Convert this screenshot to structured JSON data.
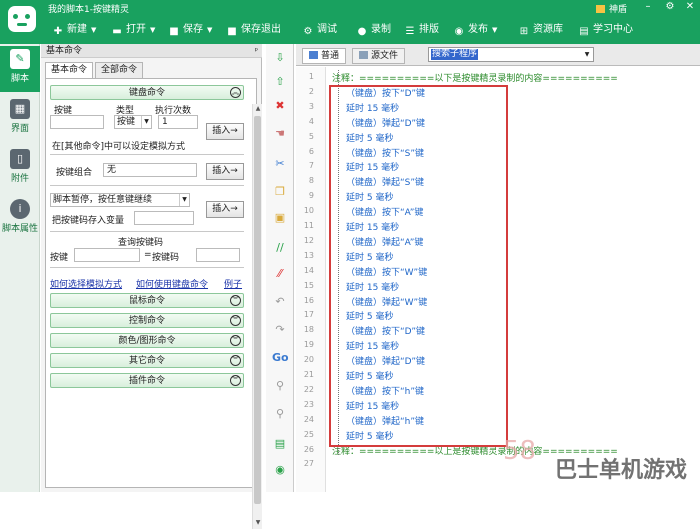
{
  "titlebar": {
    "title": "我的脚本1-按键精灵",
    "user": "神盾",
    "minimize": "–",
    "close": "✕",
    "settings": "⚙"
  },
  "toolbar": {
    "new": "新建",
    "open": "打开",
    "save": "保存",
    "save_exit": "保存退出",
    "debug": "调试",
    "record": "录制",
    "layout": "排版",
    "publish": "发布",
    "resources": "资源库",
    "learning": "学习中心"
  },
  "leftnav": {
    "items": [
      {
        "label": "脚本",
        "icon": "script-icon"
      },
      {
        "label": "界面",
        "icon": "grid-icon"
      },
      {
        "label": "附件",
        "icon": "attachment-icon"
      },
      {
        "label": "脚本属性",
        "icon": "info-icon"
      }
    ]
  },
  "cmdpanel": {
    "header": "基本命令",
    "pin": "ᵖ",
    "tabs": [
      "基本命令",
      "全部命令"
    ],
    "keyboard": {
      "group": "键盘命令",
      "col_key": "按键",
      "col_type": "类型",
      "col_count": "执行次数",
      "type_value": "按键",
      "count_value": "1",
      "insert": "插入→",
      "hint": "在[其他命令]中可以设定模拟方式",
      "combo_label": "按键组合",
      "combo_value": "无"
    },
    "pause": {
      "select_value": "脚本暂停，按任意键继续",
      "var_label": "把按键码存入变量",
      "insert": "插入→"
    },
    "query": {
      "title": "查询按键码",
      "key_label": "按键",
      "eq": "=",
      "code_label": "按键码"
    },
    "links": [
      "如何选择模拟方式",
      "如何使用键盘命令",
      "例子"
    ],
    "groups": [
      "鼠标命令",
      "控制命令",
      "颜色/图形命令",
      "其它命令",
      "插件命令"
    ]
  },
  "editor": {
    "tabs": [
      "普通",
      "源文件"
    ],
    "search": "搜索子程序",
    "lines": [
      {
        "n": "1",
        "text": "注释：==========以下是按键精灵录制的内容==========",
        "kind": "comment"
      },
      {
        "n": "2",
        "text": "（键盘）按下“D”键",
        "kind": "key"
      },
      {
        "n": "3",
        "text": "延时 15 毫秒",
        "kind": "delay"
      },
      {
        "n": "4",
        "text": "（键盘）弹起“D”键",
        "kind": "key"
      },
      {
        "n": "5",
        "text": "延时 5 毫秒",
        "kind": "delay"
      },
      {
        "n": "6",
        "text": "（键盘）按下“S”键",
        "kind": "key"
      },
      {
        "n": "7",
        "text": "延时 15 毫秒",
        "kind": "delay"
      },
      {
        "n": "8",
        "text": "（键盘）弹起“S”键",
        "kind": "key"
      },
      {
        "n": "9",
        "text": "延时 5 毫秒",
        "kind": "delay"
      },
      {
        "n": "10",
        "text": "（键盘）按下“A”键",
        "kind": "key"
      },
      {
        "n": "11",
        "text": "延时 15 毫秒",
        "kind": "delay"
      },
      {
        "n": "12",
        "text": "（键盘）弹起“A”键",
        "kind": "key"
      },
      {
        "n": "13",
        "text": "延时 5 毫秒",
        "kind": "delay"
      },
      {
        "n": "14",
        "text": "（键盘）按下“W”键",
        "kind": "key"
      },
      {
        "n": "15",
        "text": "延时 15 毫秒",
        "kind": "delay"
      },
      {
        "n": "16",
        "text": "（键盘）弹起“W”键",
        "kind": "key"
      },
      {
        "n": "17",
        "text": "延时 5 毫秒",
        "kind": "delay"
      },
      {
        "n": "18",
        "text": "（键盘）按下“D”键",
        "kind": "key"
      },
      {
        "n": "19",
        "text": "延时 15 毫秒",
        "kind": "delay"
      },
      {
        "n": "20",
        "text": "（键盘）弹起“D”键",
        "kind": "key"
      },
      {
        "n": "21",
        "text": "延时 5 毫秒",
        "kind": "delay"
      },
      {
        "n": "22",
        "text": "（键盘）按下“h”键",
        "kind": "key"
      },
      {
        "n": "23",
        "text": "延时 15 毫秒",
        "kind": "delay"
      },
      {
        "n": "24",
        "text": "（键盘）弹起“h”键",
        "kind": "key"
      },
      {
        "n": "25",
        "text": "延时 5 毫秒",
        "kind": "delay"
      },
      {
        "n": "26",
        "text": "注释：==========以上是按键精灵录制的内容==========",
        "kind": "comment"
      },
      {
        "n": "27",
        "text": "",
        "kind": "empty"
      }
    ]
  },
  "watermark": {
    "text": "巴士单机游戏",
    "num": "58"
  },
  "colors": {
    "accent": "#19a15f",
    "highlight": "#d43c3c",
    "code": "#1f66c8",
    "comment": "#2a8a2a"
  }
}
